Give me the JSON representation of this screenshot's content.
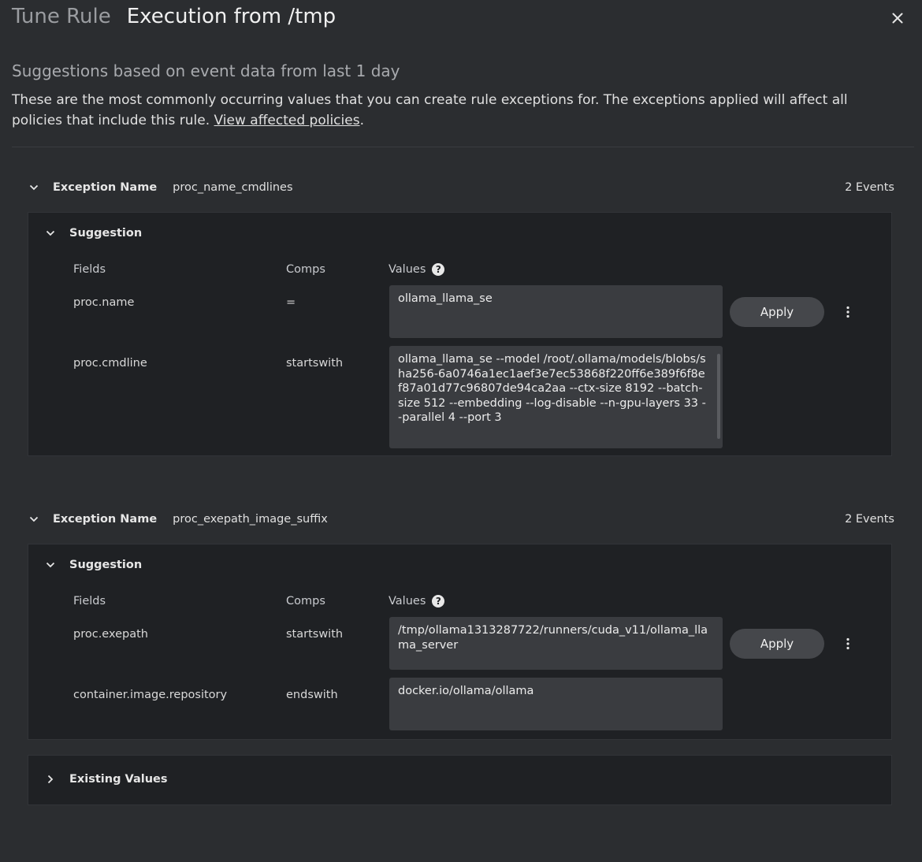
{
  "header": {
    "subtitle": "Tune Rule",
    "title": "Execution from /tmp"
  },
  "intro": {
    "heading": "Suggestions based on event data from last 1 day",
    "description": "These are the most commonly occurring values that you can create rule exceptions for. The exceptions applied will affect all policies that include this rule.",
    "link_text": "View affected policies",
    "period": "."
  },
  "table_headers": {
    "fields": "Fields",
    "comps": "Comps",
    "values": "Values"
  },
  "exceptions": [
    {
      "label": "Exception Name",
      "name": "proc_name_cmdlines",
      "events": "2 Events",
      "suggestion_label": "Suggestion",
      "apply_label": "Apply",
      "rows": [
        {
          "field": "proc.name",
          "comp": "=",
          "value": "ollama_llama_se"
        },
        {
          "field": "proc.cmdline",
          "comp": "startswith",
          "value": "ollama_llama_se --model /root/.ollama/models/blobs/sha256-6a0746a1ec1aef3e7ec53868f220ff6e389f6f8ef87a01d77c96807de94ca2aa --ctx-size 8192 --batch-size 512 --embedding --log-disable --n-gpu-layers 33 --parallel 4 --port 3"
        }
      ]
    },
    {
      "label": "Exception Name",
      "name": "proc_exepath_image_suffix",
      "events": "2 Events",
      "suggestion_label": "Suggestion",
      "apply_label": "Apply",
      "rows": [
        {
          "field": "proc.exepath",
          "comp": "startswith",
          "value": "/tmp/ollama1313287722/runners/cuda_v11/ollama_llama_server"
        },
        {
          "field": "container.image.repository",
          "comp": "endswith",
          "value": "docker.io/ollama/ollama"
        }
      ]
    }
  ],
  "existing_values": {
    "label": "Existing Values"
  },
  "icons": {
    "close": "close-icon",
    "chevron_down": "chevron-down-icon",
    "chevron_right": "chevron-right-icon",
    "help": "help-icon",
    "more": "more-vert-icon"
  },
  "colors": {
    "background": "#2b2d30",
    "panel": "#1f2124",
    "value_box": "#3a3c40",
    "button": "#45474b"
  }
}
